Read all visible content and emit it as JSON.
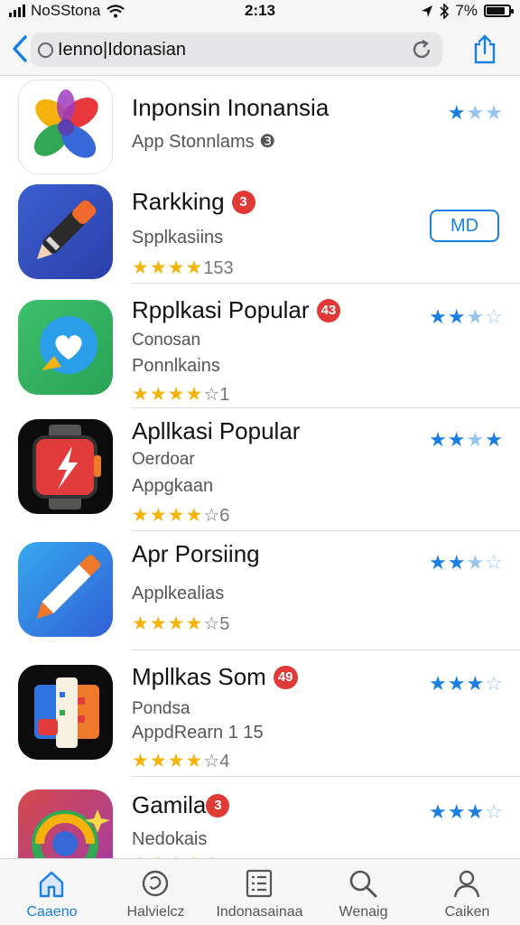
{
  "status_bar": {
    "carrier": "NoSStona",
    "time": "2:13",
    "battery": "7%",
    "battery_level": 0.85,
    "icons": [
      "signal-icon",
      "wifi-icon",
      "location-icon",
      "bluetooth-icon",
      "battery-icon"
    ]
  },
  "top_bar": {
    "search_value": "Ienno|Idonasian",
    "icons": [
      "back-chevron-icon",
      "search-icon",
      "reload-icon",
      "share-icon"
    ]
  },
  "apps": [
    {
      "title": "Inponsin Inonansia",
      "badge": "",
      "subtitle_1": "App Stonnlams ❸",
      "subtitle_2": "",
      "rating_count": "",
      "right_rating": 2,
      "button": ""
    },
    {
      "title": "Rarkking",
      "badge": "3",
      "subtitle_1": "Spplkasiins",
      "subtitle_2": "",
      "rating_count": "153",
      "right_rating": 0,
      "button": "MD"
    },
    {
      "title": "Rpplkasi Popular",
      "badge": "43",
      "subtitle_1": "Conosan",
      "subtitle_2": "Ponnlkains",
      "rating_count": "1",
      "right_rating": 2.5,
      "button": ""
    },
    {
      "title": "Apllkasi Popular",
      "badge": "",
      "subtitle_1": "Oerdoar",
      "subtitle_2": "Appgkaan",
      "rating_count": "6",
      "right_rating": 2.5,
      "button": ""
    },
    {
      "title": "Apr Porsiing",
      "badge": "",
      "subtitle_1": "Applkealias",
      "subtitle_2": "",
      "rating_count": "5",
      "right_rating": 2.5,
      "button": ""
    },
    {
      "title": "Mpllkas Som",
      "badge": "49",
      "subtitle_1": "Pondsa",
      "subtitle_2": "AppdRearn 1 15",
      "rating_count": "4",
      "right_rating": 3,
      "button": ""
    },
    {
      "title": "Gamila",
      "badge": "3",
      "subtitle_1": "Nedokais",
      "subtitle_2": "",
      "rating_count": "",
      "right_rating": 3,
      "button": ""
    }
  ],
  "tabs": [
    {
      "label": "Caaeno",
      "icon": "home-icon",
      "active": true
    },
    {
      "label": "Halvielcz",
      "icon": "games-icon",
      "active": false
    },
    {
      "label": "Indonasainaa",
      "icon": "list-icon",
      "active": false
    },
    {
      "label": "Wenaig",
      "icon": "search-icon",
      "active": false
    },
    {
      "label": "Caiken",
      "icon": "account-icon",
      "active": false
    }
  ],
  "colors": {
    "accent": "#1a7fe0",
    "badge": "#e03a36",
    "star_gold": "#f2b40a"
  }
}
